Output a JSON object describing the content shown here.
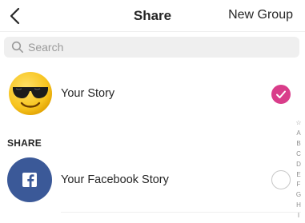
{
  "header": {
    "title": "Share",
    "new_group_label": "New Group"
  },
  "search": {
    "placeholder": "Search"
  },
  "your_story": {
    "label": "Your Story",
    "selected": true
  },
  "share_section": {
    "header": "SHARE",
    "items": [
      {
        "label": "Your Facebook Story",
        "icon": "facebook-icon",
        "selected": false
      }
    ]
  },
  "index_bar": [
    "☆",
    "A",
    "B",
    "C",
    "D",
    "E",
    "F",
    "G",
    "H",
    "I"
  ],
  "colors": {
    "accent": "#d93d8a",
    "facebook": "#3b5998"
  }
}
